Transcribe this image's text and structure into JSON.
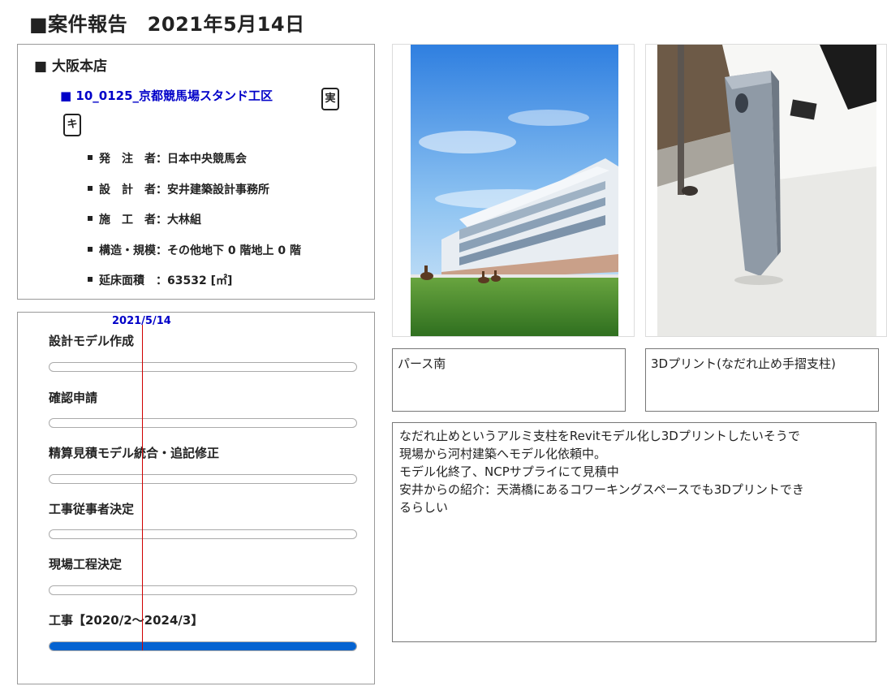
{
  "page": {
    "title": "■案件報告　2021年5月14日"
  },
  "project": {
    "branch": "■ 大阪本店",
    "name": "■ 10_0125_京都競馬場スタンド工区",
    "tags": [
      "実",
      "キ"
    ],
    "info": [
      {
        "label": "発　注　者：",
        "value": "日本中央競馬会"
      },
      {
        "label": "設　計　者：",
        "value": "安井建築設計事務所"
      },
      {
        "label": "施　工　者：",
        "value": "大林組"
      },
      {
        "label": "構造・規模：",
        "value": "その他地下 0 階地上 0 階"
      },
      {
        "label": "延床面積　：",
        "value": "63532 [㎡]"
      }
    ]
  },
  "progress": {
    "today_label": "2021/5/14",
    "tasks": [
      {
        "label": "設計モデル作成",
        "progress": 0
      },
      {
        "label": "確認申請",
        "progress": 0
      },
      {
        "label": "精算見積モデル統合・追記修正",
        "progress": 0
      },
      {
        "label": "工事従事者決定",
        "progress": 0
      },
      {
        "label": "現場工程決定",
        "progress": 0
      },
      {
        "label": "工事【2020/2～2024/3】",
        "progress": 1.0
      }
    ],
    "colors": {
      "bar_fill": "#0563d1",
      "today_line": "#d00000",
      "today_text": "#0000c8"
    }
  },
  "photos": [
    {
      "caption": "パース南",
      "icon": "stadium-rendering-image"
    },
    {
      "caption": "3Dプリント(なだれ止め手摺支柱)",
      "icon": "3d-print-photo-image"
    }
  ],
  "notes": [
    "なだれ止めというアルミ支柱をRevitモデル化し3Dプリントしたいそうで",
    "現場から河村建築へモデル化依頼中。",
    "モデル化終了、NCPサプライにて見積中",
    "安井からの紹介：天満橋にあるコワーキングスペースでも3Dプリントでき",
    "るらしい"
  ],
  "colors": {
    "link_blue": "#0000c8",
    "border": "#9a9a9a"
  }
}
